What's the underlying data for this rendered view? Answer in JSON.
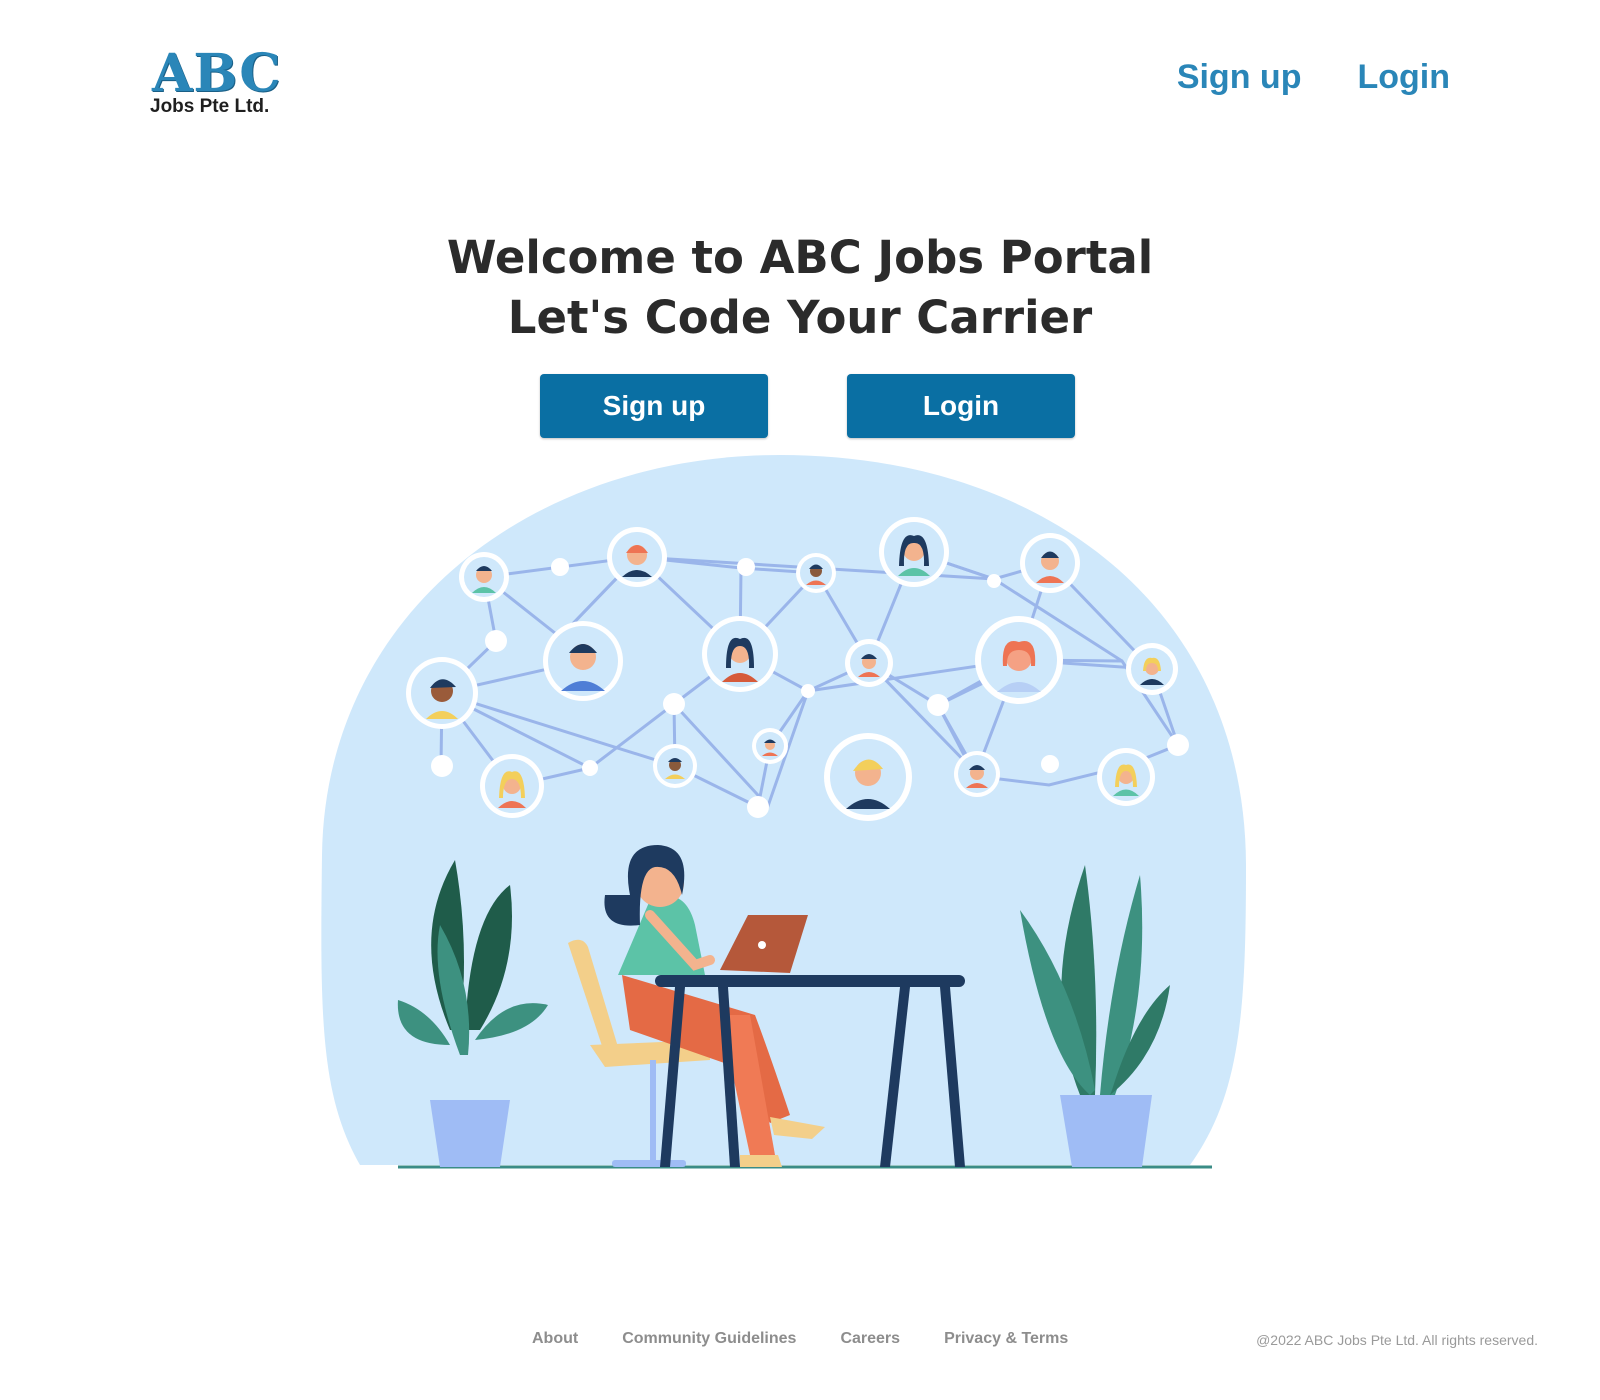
{
  "header": {
    "logo_mark": "ABC",
    "logo_sub": "Jobs Pte Ltd.",
    "nav": {
      "signup_label": "Sign up",
      "login_label": "Login"
    }
  },
  "hero": {
    "title_line1": "Welcome to ABC Jobs Portal",
    "title_line2": "Let's Code Your Carrier",
    "signup_button": "Sign up",
    "login_button": "Login"
  },
  "illustration": {
    "icon": "networking-illustration"
  },
  "footer": {
    "links": [
      "About",
      "Community Guidelines",
      "Careers",
      "Privacy & Terms"
    ],
    "copyright": "@2022 ABC Jobs Pte Ltd. All rights reserved."
  },
  "colors": {
    "brand": "#2a86b8",
    "button": "#0a6fa3",
    "hero_bg": "#cfe8fb",
    "footer_text": "#8d8d8d"
  }
}
